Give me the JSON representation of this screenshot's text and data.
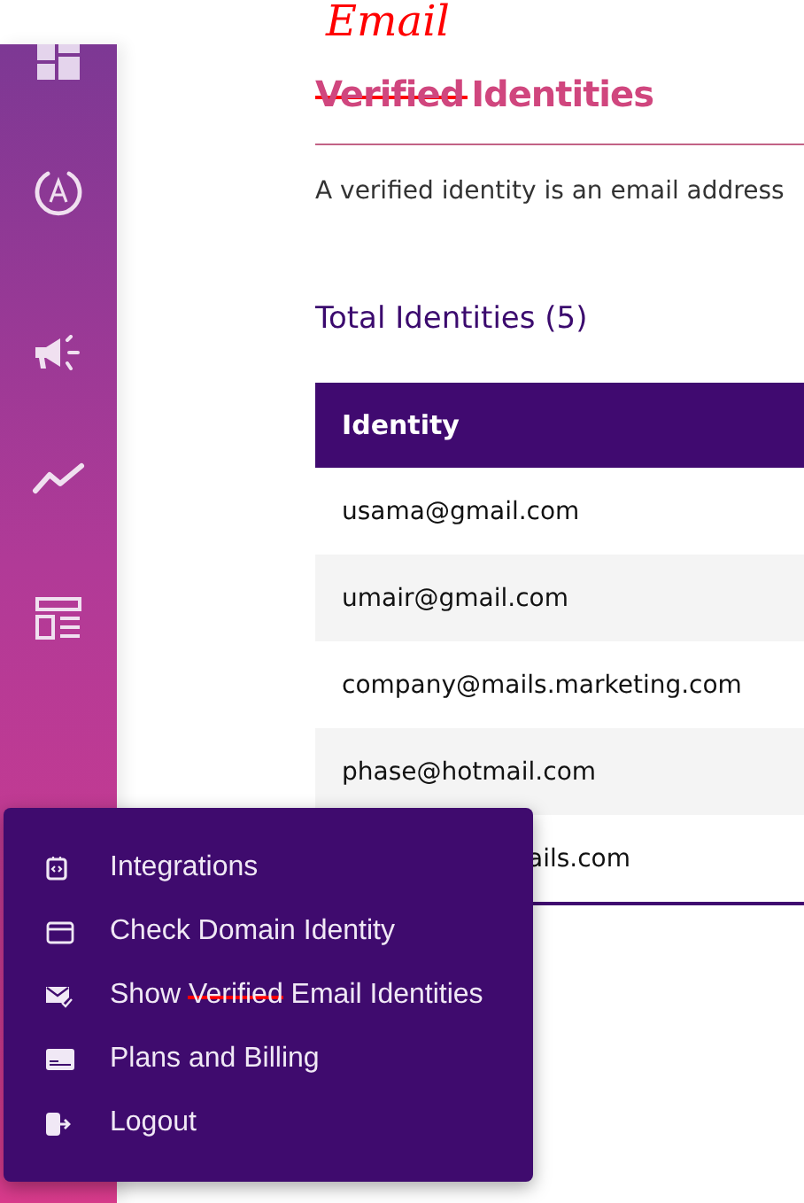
{
  "sidebar": {
    "items": [
      {
        "kind": "dashboard"
      },
      {
        "kind": "autoresponder"
      },
      {
        "kind": "campaigns"
      },
      {
        "kind": "analytics"
      },
      {
        "kind": "templates"
      }
    ]
  },
  "header": {
    "annotation": "Email",
    "title_parts": [
      {
        "text": "Verified",
        "struck": true
      },
      {
        "text": "Identities",
        "struck": false
      }
    ]
  },
  "description": "A verified identity is an email address",
  "total": "Total Identities (5)",
  "table": {
    "columns": [
      "Identity"
    ],
    "rows": [
      {
        "identity": "usama@gmail.com",
        "covered": false
      },
      {
        "identity": "umair@gmail.com",
        "covered": false
      },
      {
        "identity": "company@mails.marketing.com",
        "covered": false
      },
      {
        "identity": "phase@hotmail.com",
        "covered": false
      },
      {
        "identity": "ails.com",
        "covered": true
      }
    ]
  },
  "menu": {
    "items": [
      {
        "kind": "integrations",
        "parts": [
          {
            "text": "Integrations",
            "struck": false
          }
        ]
      },
      {
        "kind": "domain",
        "parts": [
          {
            "text": "Check Domain Identity",
            "struck": false
          }
        ]
      },
      {
        "kind": "email",
        "parts": [
          {
            "text": "Show ",
            "struck": false
          },
          {
            "text": "Verified",
            "struck": true
          },
          {
            "text": " Email Identities",
            "struck": false
          }
        ]
      },
      {
        "kind": "billing",
        "parts": [
          {
            "text": "Plans and Billing",
            "struck": false
          }
        ]
      },
      {
        "kind": "logout",
        "parts": [
          {
            "text": "Logout",
            "struck": false
          }
        ]
      }
    ]
  }
}
